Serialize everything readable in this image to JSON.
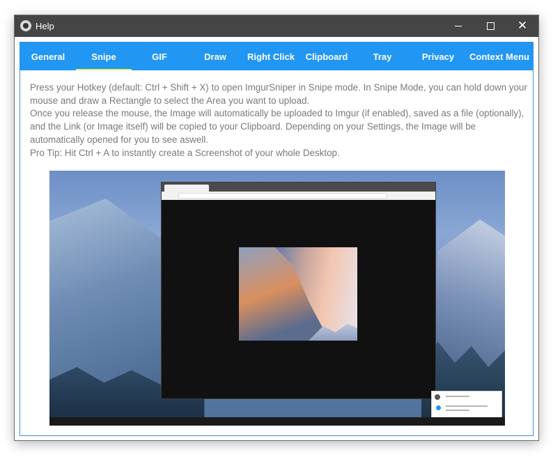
{
  "window": {
    "title": "Help",
    "minimize_icon": "minimize-icon",
    "maximize_icon": "maximize-icon",
    "close_icon": "close-icon"
  },
  "tabs": [
    {
      "label": "General",
      "active": false
    },
    {
      "label": "Snipe",
      "active": true
    },
    {
      "label": "GIF",
      "active": false
    },
    {
      "label": "Draw",
      "active": false
    },
    {
      "label": "Right Click",
      "active": false
    },
    {
      "label": "Clipboard",
      "active": false
    },
    {
      "label": "Tray",
      "active": false
    },
    {
      "label": "Privacy",
      "active": false
    },
    {
      "label": "Context Menu",
      "active": false
    }
  ],
  "description": [
    "Press your Hotkey (default: Ctrl + Shift + X) to open ImgurSniper in Snipe mode. In Snipe Mode, you can hold down your mouse and draw a Rectangle to select the Area you want to upload.",
    "Once you release the mouse, the Image will automatically be uploaded to Imgur (if enabled), saved as a file (optionally), and the Link (or Image itself) will be copied to your Clipboard. Depending on your Settings, the Image will be automatically opened for you to see aswell.",
    "Pro Tip: Hit Ctrl + A to instantly create a Screenshot of your whole Desktop."
  ],
  "colors": {
    "titlebar": "#454545",
    "tabbar": "#2196f3",
    "active_tab_underline": "#e6f06e",
    "text": "#7a7a7a"
  }
}
